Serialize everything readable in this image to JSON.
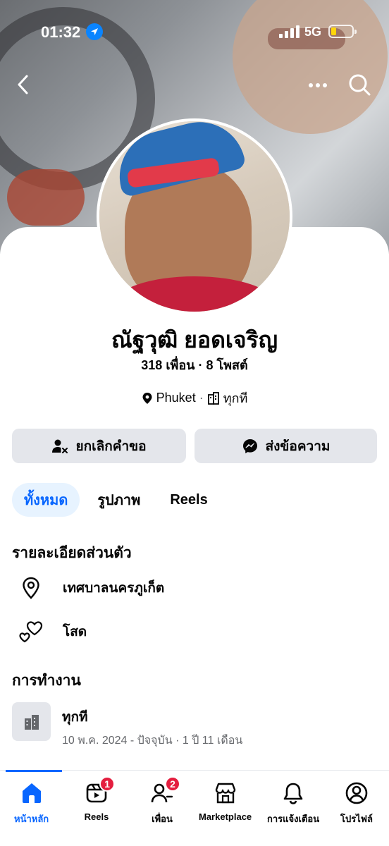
{
  "status_bar": {
    "time": "01:32",
    "network": "5G"
  },
  "profile": {
    "name": "ณัฐวุฒิ ยอดเจริญ",
    "friends_count": "318 เพื่อน",
    "posts_count": "8 โพสต์",
    "location": "Phuket",
    "workplace": "ทุกที"
  },
  "actions": {
    "cancel_request_label": "ยกเลิกคำขอ",
    "message_label": "ส่งข้อความ"
  },
  "tabs": [
    {
      "label": "ทั้งหมด",
      "active": true
    },
    {
      "label": "รูปภาพ",
      "active": false
    },
    {
      "label": "Reels",
      "active": false
    }
  ],
  "personal_details": {
    "title": "รายละเอียดส่วนตัว",
    "city": "เทศบาลนครภูเก็ต",
    "relationship": "โสด"
  },
  "work": {
    "title": "การทำงาน",
    "company": "ทุกที",
    "period": "10 พ.ค. 2024 - ปัจจุบัน · 1 ปี 11 เดือน"
  },
  "bottom_nav": [
    {
      "label": "หน้าหลัก",
      "icon": "home-icon",
      "active": true,
      "badge": ""
    },
    {
      "label": "Reels",
      "icon": "reels-icon",
      "active": false,
      "badge": "1"
    },
    {
      "label": "เพื่อน",
      "icon": "friends-icon",
      "active": false,
      "badge": "2"
    },
    {
      "label": "Marketplace",
      "icon": "marketplace-icon",
      "active": false,
      "badge": ""
    },
    {
      "label": "การแจ้งเตือน",
      "icon": "bell-icon",
      "active": false,
      "badge": ""
    },
    {
      "label": "โปรไฟล์",
      "icon": "profile-icon",
      "active": false,
      "badge": ""
    }
  ],
  "colors": {
    "accent": "#0866ff",
    "badge": "#e41e3f",
    "button_bg": "#e4e6eb",
    "active_tab_bg": "#e7f3ff"
  }
}
